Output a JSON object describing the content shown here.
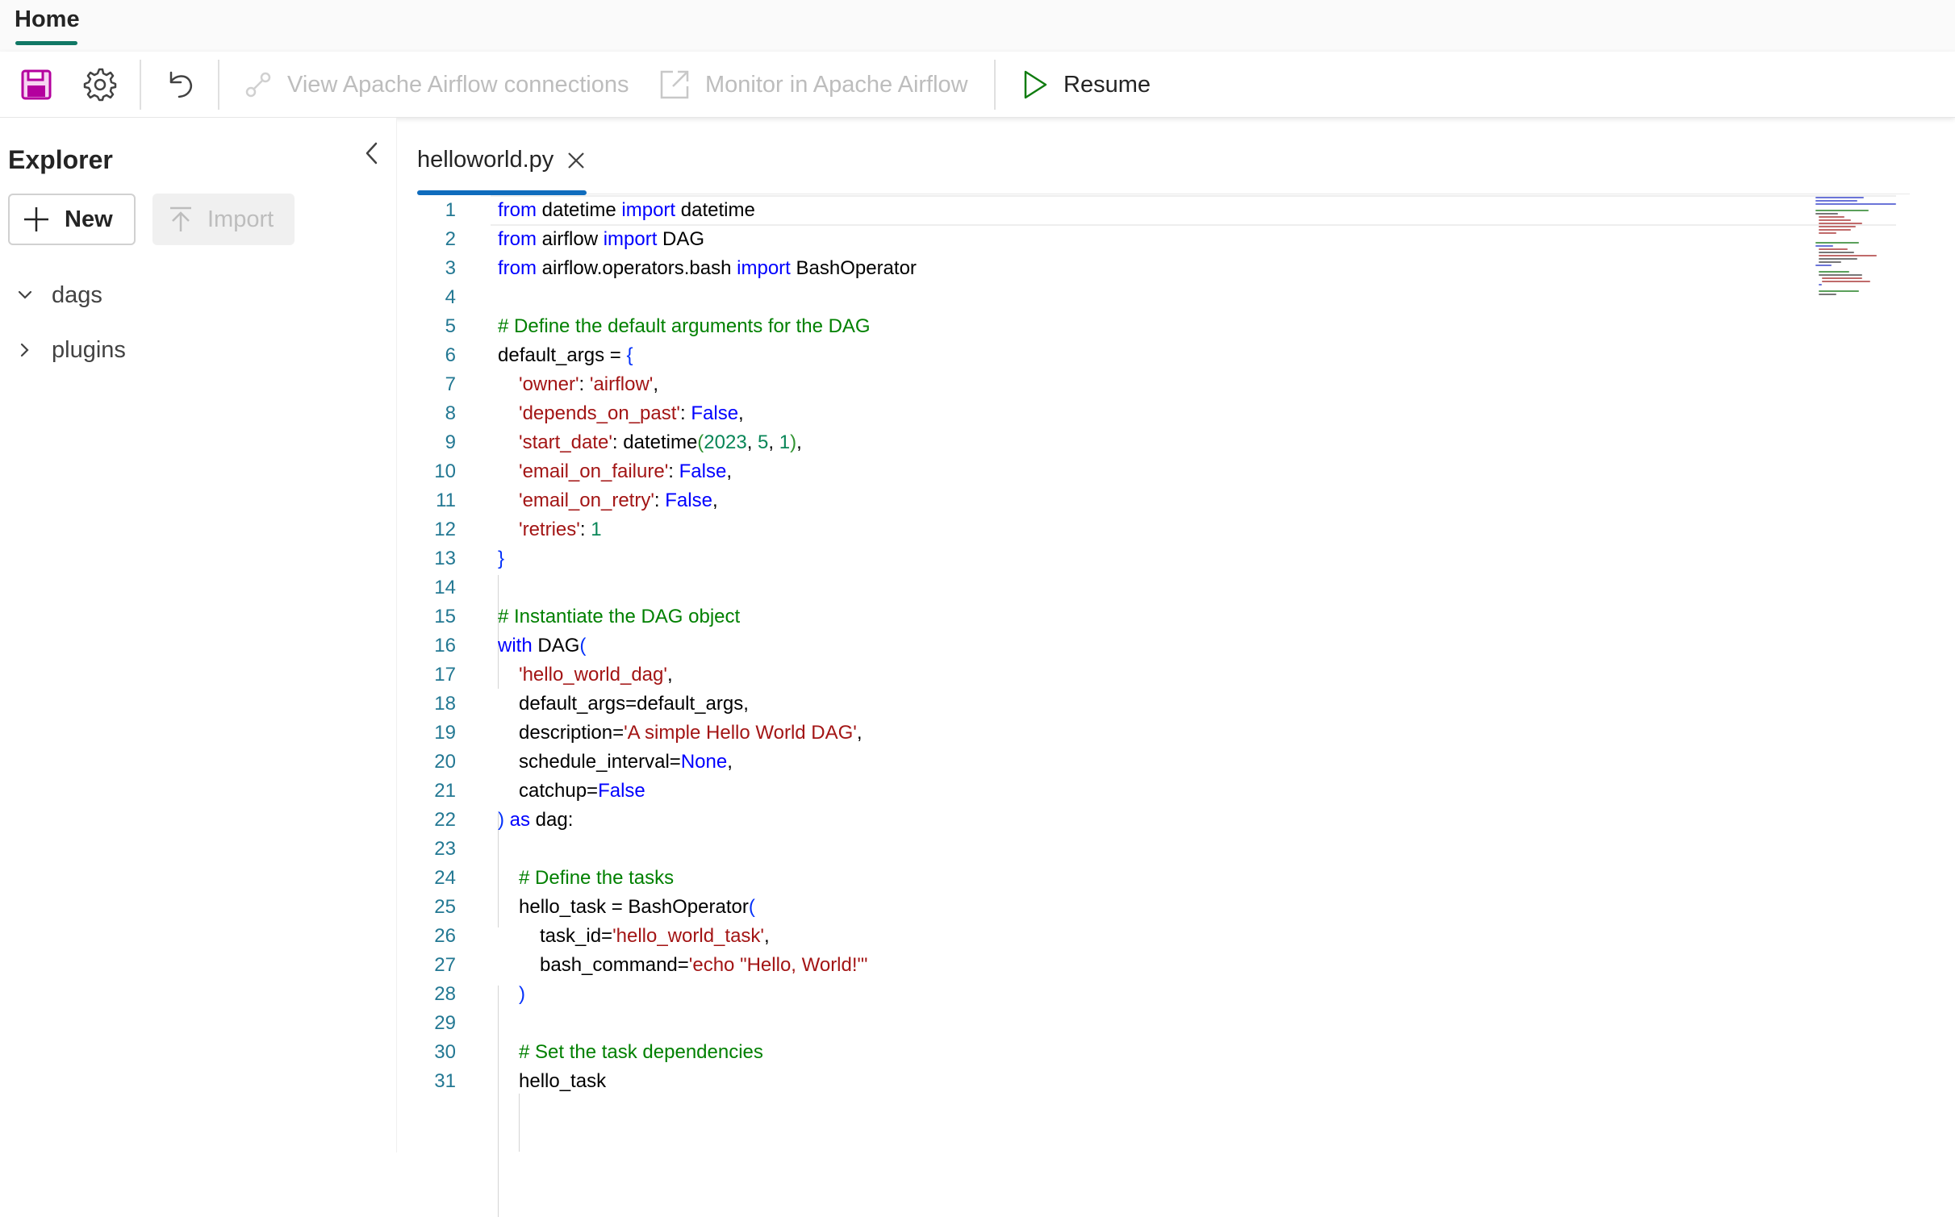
{
  "topbar": {
    "home_tab": "Home"
  },
  "toolbar": {
    "view_connections": "View Apache Airflow connections",
    "monitor": "Monitor in Apache Airflow",
    "resume": "Resume"
  },
  "explorer": {
    "title": "Explorer",
    "new_label": "New",
    "import_label": "Import",
    "folders": [
      "dags",
      "plugins"
    ]
  },
  "editor": {
    "file_tab": "helloworld.py",
    "line_numbers": [
      "1",
      "2",
      "3",
      "4",
      "5",
      "6",
      "7",
      "8",
      "9",
      "10",
      "11",
      "12",
      "13",
      "14",
      "15",
      "16",
      "17",
      "18",
      "19",
      "20",
      "21",
      "22",
      "23",
      "24",
      "25",
      "26",
      "27",
      "28",
      "29",
      "30",
      "31"
    ],
    "code": {
      "l1_from": "from",
      "l1_mod": " datetime ",
      "l1_import": "import",
      "l1_name": " datetime",
      "l2_from": "from",
      "l2_mod": " airflow ",
      "l2_import": "import",
      "l2_name": " DAG",
      "l3_from": "from",
      "l3_mod": " airflow.operators.bash ",
      "l3_import": "import",
      "l3_name": " BashOperator",
      "l5_comment": "# Define the default arguments for the DAG",
      "l6_a": "default_args = ",
      "l6_brace": "{",
      "l7_key": "'owner'",
      "l7_sep": ": ",
      "l7_val": "'airflow'",
      "l7_end": ",",
      "l8_key": "'depends_on_past'",
      "l8_sep": ": ",
      "l8_val": "False",
      "l8_end": ",",
      "l9_key": "'start_date'",
      "l9_sep": ": datetime",
      "l9_p1": "(",
      "l9_n1": "2023",
      "l9_c1": ", ",
      "l9_n2": "5",
      "l9_c2": ", ",
      "l9_n3": "1",
      "l9_p2": ")",
      "l9_end": ",",
      "l10_key": "'email_on_failure'",
      "l10_sep": ": ",
      "l10_val": "False",
      "l10_end": ",",
      "l11_key": "'email_on_retry'",
      "l11_sep": ": ",
      "l11_val": "False",
      "l11_end": ",",
      "l12_key": "'retries'",
      "l12_sep": ": ",
      "l12_val": "1",
      "l13_brace": "}",
      "l15_comment": "# Instantiate the DAG object",
      "l16_with": "with",
      "l16_dag": " DAG",
      "l16_paren": "(",
      "l17_str": "'hello_world_dag'",
      "l17_end": ",",
      "l18_text": "default_args=default_args,",
      "l19_a": "description=",
      "l19_str": "'A simple Hello World DAG'",
      "l19_end": ",",
      "l20_a": "schedule_interval=",
      "l20_val": "None",
      "l20_end": ",",
      "l21_a": "catchup=",
      "l21_val": "False",
      "l22_paren": ")",
      "l22_as": " as",
      "l22_b": " dag:",
      "l24_comment": "# Define the tasks",
      "l25_a": "hello_task = BashOperator",
      "l25_paren": "(",
      "l26_a": "task_id=",
      "l26_str": "'hello_world_task'",
      "l26_end": ",",
      "l27_a": "bash_command=",
      "l27_str": "'echo \"Hello, World!\"'",
      "l28_paren": ")",
      "l30_comment": "# Set the task dependencies",
      "l31_text": "hello_task"
    }
  },
  "colors": {
    "keyword": "#0000ff",
    "string": "#a31515",
    "comment": "#008000",
    "number": "#098658",
    "line_number": "#237893",
    "accent_tab": "#0f6cbd",
    "home_underline": "#117865",
    "save_icon": "#b4009e",
    "resume_icon": "#107c10"
  },
  "icons": [
    "save-icon",
    "settings-icon",
    "undo-icon",
    "link-icon",
    "open-external-icon",
    "play-icon",
    "chevron-left-icon",
    "plus-icon",
    "upload-icon",
    "chevron-down-icon",
    "chevron-right-icon",
    "close-icon"
  ]
}
